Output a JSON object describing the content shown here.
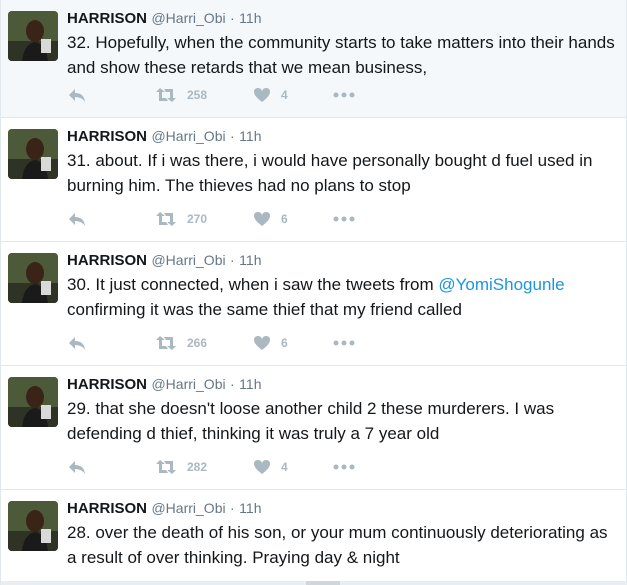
{
  "colors": {
    "name": "#14171a",
    "meta": "#657786",
    "icon": "#aab8c2",
    "mention": "#1b95e0",
    "divider": "#e1e8ed",
    "highlight_bg": "#f5f8fa"
  },
  "icons": {
    "reply": "reply-icon",
    "retweet": "retweet-icon",
    "like": "heart-icon",
    "more": "more-dots-icon"
  },
  "tweets": [
    {
      "fullname": "HARRISON",
      "username": "@Harri_Obi",
      "separator": "·",
      "time": "11h",
      "text_before": "32. Hopefully, when the community starts to take matters into their hands and show these retards that we mean business,",
      "mention": "",
      "text_after": "",
      "retweets": "258",
      "likes": "4"
    },
    {
      "fullname": "HARRISON",
      "username": "@Harri_Obi",
      "separator": "·",
      "time": "11h",
      "text_before": "31. about. If i was there, i would have personally bought d fuel used in burning him. The thieves had no plans to stop",
      "mention": "",
      "text_after": "",
      "retweets": "270",
      "likes": "6"
    },
    {
      "fullname": "HARRISON",
      "username": "@Harri_Obi",
      "separator": "·",
      "time": "11h",
      "text_before": "30. It just connected, when i saw the tweets from ",
      "mention": "@YomiShogunle",
      "text_after": " confirming it was the same thief that my friend called",
      "retweets": "266",
      "likes": "6"
    },
    {
      "fullname": "HARRISON",
      "username": "@Harri_Obi",
      "separator": "·",
      "time": "11h",
      "text_before": "29. that she doesn't loose another child 2 these murderers. I was defending d thief, thinking it was truly a 7 year old",
      "mention": "",
      "text_after": "",
      "retweets": "282",
      "likes": "4"
    },
    {
      "fullname": "HARRISON",
      "username": "@Harri_Obi",
      "separator": "·",
      "time": "11h",
      "text_before": "28. over the death of his son, or your mum continuously deteriorating as a result of over thinking. Praying day & night",
      "mention": "",
      "text_after": "",
      "retweets": "",
      "likes": ""
    }
  ]
}
